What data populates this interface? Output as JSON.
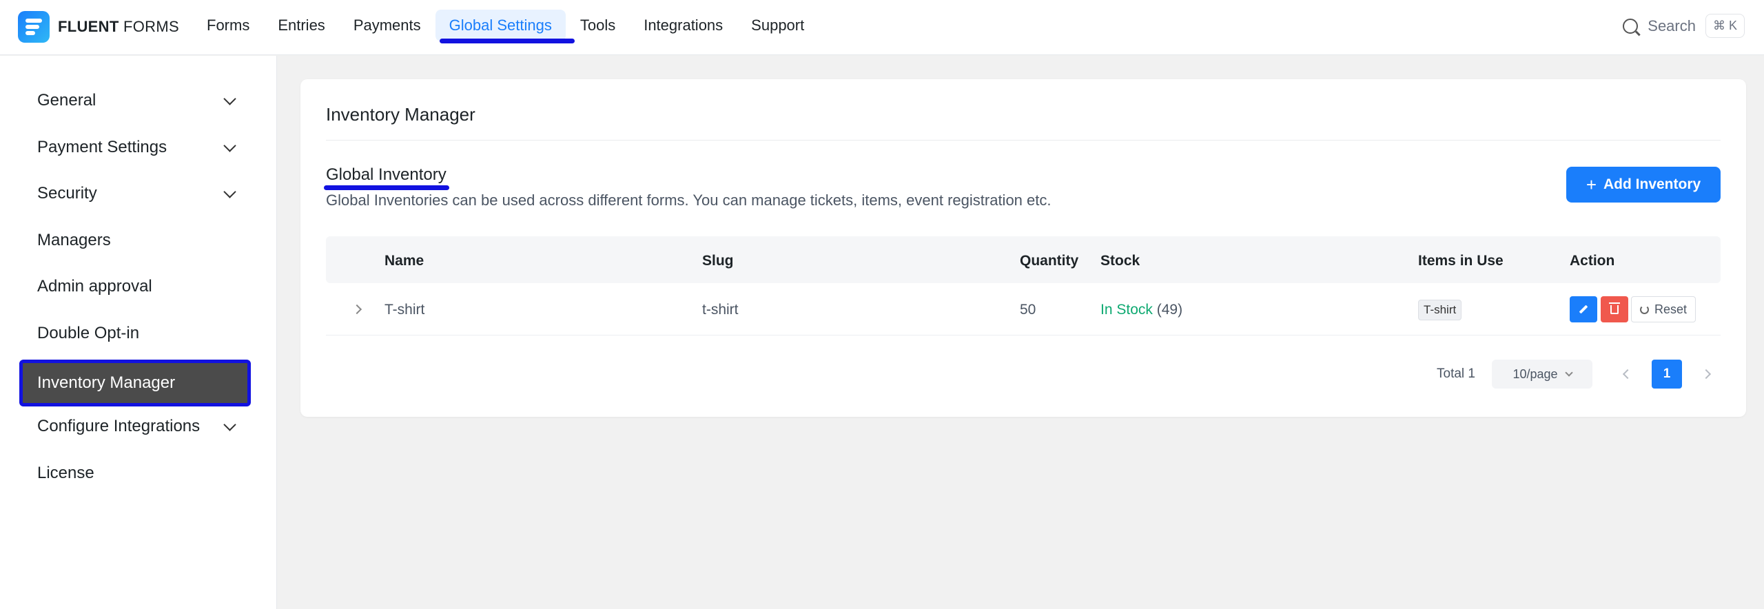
{
  "brand": {
    "bold": "FLUENT",
    "light": "FORMS"
  },
  "nav": {
    "items": [
      {
        "label": "Forms"
      },
      {
        "label": "Entries"
      },
      {
        "label": "Payments"
      },
      {
        "label": "Global Settings",
        "active": true
      },
      {
        "label": "Tools"
      },
      {
        "label": "Integrations"
      },
      {
        "label": "Support"
      }
    ],
    "search_label": "Search",
    "search_shortcut": "⌘ K"
  },
  "sidebar": {
    "items": [
      {
        "label": "General",
        "has_children": true
      },
      {
        "label": "Payment Settings",
        "has_children": true
      },
      {
        "label": "Security",
        "has_children": true
      },
      {
        "label": "Managers",
        "has_children": false
      },
      {
        "label": "Admin approval",
        "has_children": false
      },
      {
        "label": "Double Opt-in",
        "has_children": false
      },
      {
        "label": "Inventory Manager",
        "has_children": false,
        "active": true
      },
      {
        "label": "Configure Integrations",
        "has_children": true
      },
      {
        "label": "License",
        "has_children": false
      }
    ]
  },
  "main": {
    "title": "Inventory Manager",
    "section_title": "Global Inventory",
    "section_description": "Global Inventories can be used across different forms. You can manage tickets, items, event registration etc.",
    "add_button": "Add Inventory",
    "table": {
      "headers": {
        "name": "Name",
        "slug": "Slug",
        "quantity": "Quantity",
        "stock": "Stock",
        "items_in_use": "Items in Use",
        "action": "Action"
      },
      "rows": [
        {
          "name": "T-shirt",
          "slug": "t-shirt",
          "quantity": "50",
          "stock_status": "In Stock",
          "stock_count": "(49)",
          "item_tag": "T-shirt",
          "reset_label": "Reset"
        }
      ]
    },
    "pagination": {
      "total": "Total 1",
      "page_size": "10/page",
      "current_page": "1"
    }
  },
  "colors": {
    "accent": "#1a7efb",
    "danger": "#f0584d",
    "success": "#0ea971",
    "highlight": "#1212e0"
  }
}
